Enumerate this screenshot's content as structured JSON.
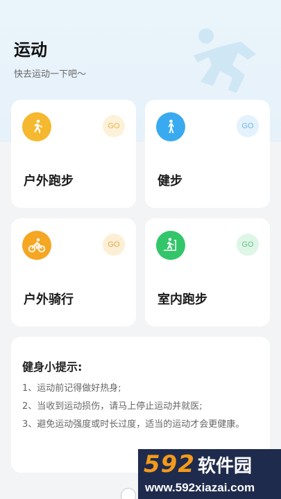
{
  "header": {
    "title": "运动",
    "subtitle": "快去运动一下吧～"
  },
  "cards": [
    {
      "label": "户外跑步",
      "go": "GO",
      "icon": "running-icon",
      "color": "#f5b82e",
      "go_bg": "#fdf1d9",
      "go_fg": "#e8b34a"
    },
    {
      "label": "健步",
      "go": "GO",
      "icon": "walking-icon",
      "color": "#3aaaf0",
      "go_bg": "#e3f2fc",
      "go_fg": "#6db5e6"
    },
    {
      "label": "户外骑行",
      "go": "GO",
      "icon": "cycling-icon",
      "color": "#f5a623",
      "go_bg": "#fdefd6",
      "go_fg": "#e3a54a"
    },
    {
      "label": "室内跑步",
      "go": "GO",
      "icon": "treadmill-icon",
      "color": "#33c56a",
      "go_bg": "#dff6e7",
      "go_fg": "#5cc386"
    }
  ],
  "tips": {
    "title": "健身小提示:",
    "items": [
      "1、运动前记得做好热身;",
      "2、当收到运动损伤，请马上停止运动并就医;",
      "3、避免运动强度或时长过度，适当的运动才会更健康。"
    ]
  },
  "watermark": {
    "number": "592",
    "name": "软件园",
    "url": "www.592xiazai.com"
  }
}
